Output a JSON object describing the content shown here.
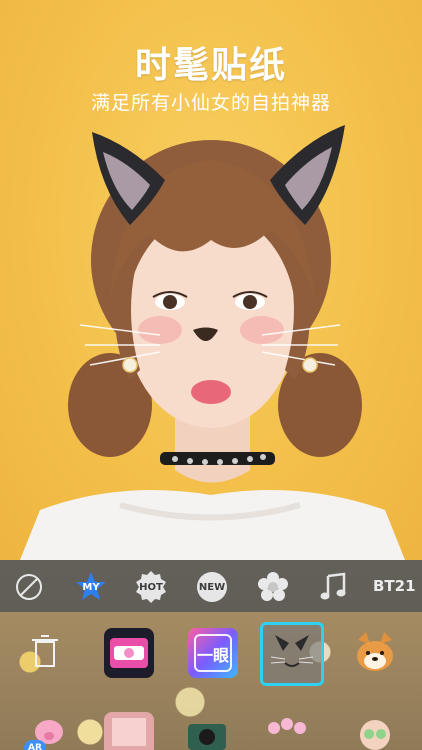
{
  "headline": "时髦贴纸",
  "subline": "满足所有小仙女的自拍神器",
  "tabs": [
    {
      "id": "none",
      "label": ""
    },
    {
      "id": "my",
      "label": "MY"
    },
    {
      "id": "hot",
      "label": "HOT"
    },
    {
      "id": "new",
      "label": "NEW"
    },
    {
      "id": "flower",
      "label": ""
    },
    {
      "id": "music",
      "label": ""
    },
    {
      "id": "bt21",
      "label": "BT21"
    }
  ],
  "stickers": {
    "row1": [
      "trash-icon",
      "hello-kitty-frame",
      "一眼",
      "cat-ears-selected",
      "shiba-dog"
    ],
    "yiyan_label": "一眼",
    "ar_badge": "AR"
  },
  "colors": {
    "background": "#f4c24e",
    "tabbar": "#474747",
    "selection": "#2fd0f0"
  }
}
